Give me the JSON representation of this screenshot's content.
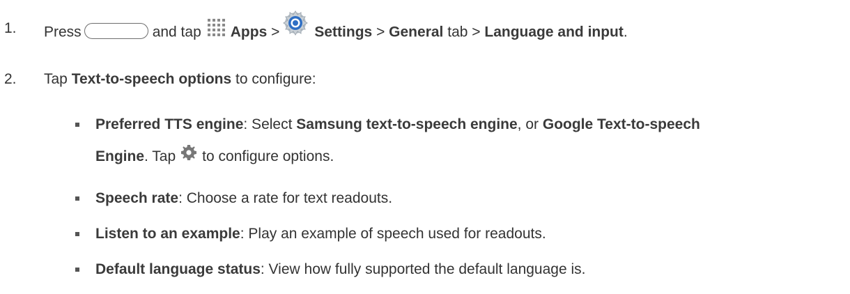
{
  "steps": [
    {
      "number": "1.",
      "press": "Press",
      "and_tap": "and tap",
      "apps": "Apps",
      "sep1": ">",
      "settings": "Settings",
      "sep2": ">",
      "general": "General",
      "tab": "tab",
      "sep3": ">",
      "language": "Language and input",
      "end": "."
    },
    {
      "number": "2.",
      "tap": "Tap",
      "option": "Text-to-speech options",
      "rest": "to configure:"
    }
  ],
  "options": [
    {
      "title": "Preferred TTS engine",
      "select": ": Select",
      "samsung": "Samsung text-to-speech engine",
      "or": ", or",
      "google": "Google Text-to-speech",
      "engine": "Engine",
      "tap": ". Tap",
      "configure": "to configure options."
    },
    {
      "title": "Speech rate",
      "desc": ": Choose a rate for text readouts."
    },
    {
      "title": "Listen to an example",
      "desc": ": Play an example of speech used for readouts."
    },
    {
      "title": "Default language status",
      "desc": ": View how fully supported the default language is."
    }
  ],
  "icons": {
    "home": "home-button-icon",
    "apps": "apps-icon",
    "settings": "settings-icon",
    "options": "gear-icon"
  },
  "colors": {
    "text": "#333333",
    "settings_blue": "#2f6fc4",
    "gear_gray": "#777777"
  }
}
